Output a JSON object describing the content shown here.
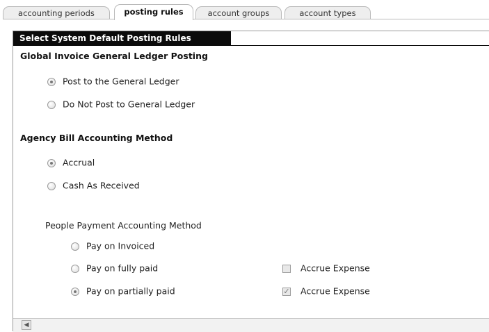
{
  "tabs": [
    {
      "label": "accounting periods",
      "active": false
    },
    {
      "label": "posting rules",
      "active": true
    },
    {
      "label": "account groups",
      "active": false
    },
    {
      "label": "account types",
      "active": false
    }
  ],
  "panel": {
    "header": "Select System Default Posting Rules"
  },
  "global_invoice": {
    "title": "Global Invoice General Ledger Posting",
    "options": [
      {
        "label": "Post to the General Ledger",
        "checked": true
      },
      {
        "label": "Do Not Post to General Ledger",
        "checked": false
      }
    ]
  },
  "agency_bill": {
    "title": "Agency Bill Accounting Method",
    "options": [
      {
        "label": "Accrual",
        "checked": true
      },
      {
        "label": "Cash As Received",
        "checked": false
      }
    ]
  },
  "people_payment": {
    "title": "People Payment Accounting Method",
    "options": [
      {
        "label": "Pay on Invoiced",
        "checked": false
      },
      {
        "label": "Pay on fully paid",
        "checked": false
      },
      {
        "label": "Pay on partially paid",
        "checked": true
      }
    ],
    "accrue": [
      {
        "label": "Accrue Expense",
        "checked": false
      },
      {
        "label": "Accrue Expense",
        "checked": true
      }
    ]
  },
  "scrollbar": {
    "left_arrow_icon": "chevron-left-icon"
  }
}
